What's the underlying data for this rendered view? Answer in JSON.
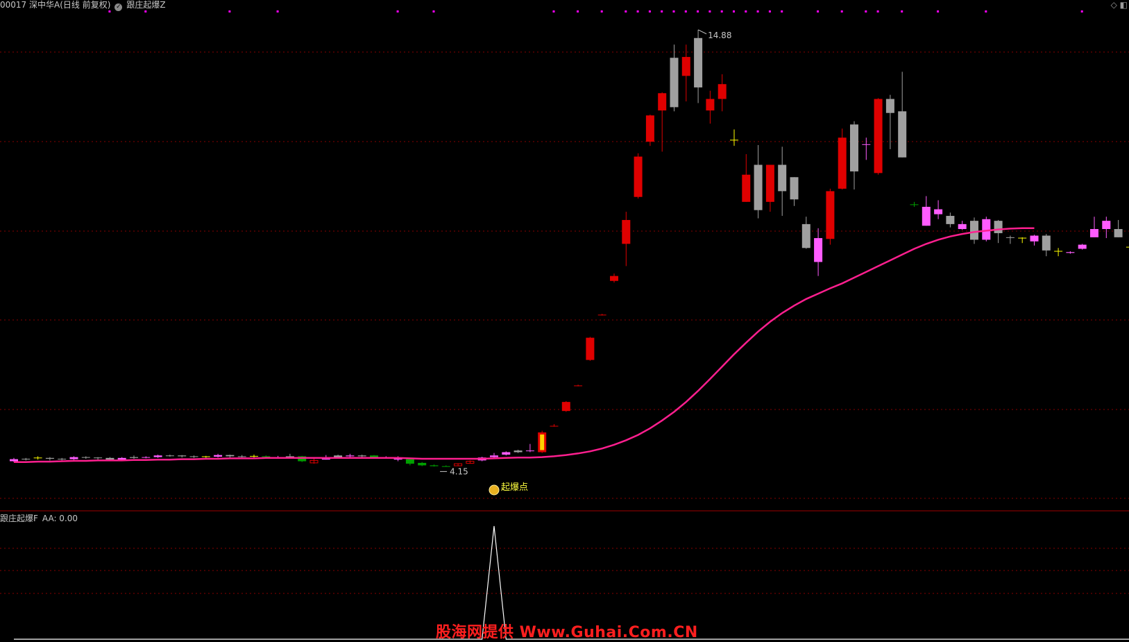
{
  "header": {
    "stock": "00017 深中华A(日线 前复权)",
    "indicator": "跟庄起爆Z"
  },
  "topright_icons": "◇ ◧",
  "sub_header": {
    "indicator": "跟庄起爆F",
    "aa": "AA: 0.00"
  },
  "watermark": "股海网提供 Www.Guhai.Com.CN",
  "colors": {
    "up": "#e00000",
    "down": "#00a000",
    "gray": "#a0a0a0",
    "magenta": "#ff5cff",
    "ma": "#ff1f8f",
    "grid": "#8a0000",
    "signal": "#ff00ff",
    "doji": "#ffff00"
  },
  "chart_data": [
    {
      "type": "candlestick",
      "ylim": [
        3.6,
        15.3
      ],
      "annotations": {
        "high_label": "14.88",
        "low_label": "4.15",
        "signal_label": "起爆点",
        "signal_icon": "money-bag-icon"
      },
      "candles": [
        [
          4.4,
          4.45,
          4.48,
          4.38,
          "m"
        ],
        [
          4.45,
          4.46,
          4.48,
          4.42,
          "g"
        ],
        [
          4.48,
          4.48,
          4.52,
          4.44,
          "y"
        ],
        [
          4.48,
          4.46,
          4.5,
          4.42,
          "g"
        ],
        [
          4.46,
          4.45,
          4.48,
          4.42,
          "g"
        ],
        [
          4.45,
          4.5,
          4.52,
          4.43,
          "m"
        ],
        [
          4.5,
          4.49,
          4.52,
          4.46,
          "g"
        ],
        [
          4.49,
          4.48,
          4.5,
          4.44,
          "g"
        ],
        [
          4.48,
          4.44,
          4.5,
          4.42,
          "g"
        ],
        [
          4.44,
          4.48,
          4.5,
          4.42,
          "m"
        ],
        [
          4.48,
          4.5,
          4.54,
          4.46,
          "g"
        ],
        [
          4.5,
          4.5,
          4.52,
          4.47,
          "m"
        ],
        [
          4.5,
          4.54,
          4.56,
          4.48,
          "m"
        ],
        [
          4.54,
          4.54,
          4.56,
          4.51,
          "g"
        ],
        [
          4.54,
          4.52,
          4.55,
          4.49,
          "g"
        ],
        [
          4.52,
          4.51,
          4.54,
          4.48,
          "g"
        ],
        [
          4.51,
          4.51,
          4.53,
          4.48,
          "y"
        ],
        [
          4.51,
          4.55,
          4.58,
          4.49,
          "m"
        ],
        [
          4.55,
          4.52,
          4.56,
          4.49,
          "g"
        ],
        [
          4.52,
          4.52,
          4.55,
          4.49,
          "g"
        ],
        [
          4.52,
          4.52,
          4.56,
          4.48,
          "y"
        ],
        [
          4.52,
          4.5,
          4.54,
          4.47,
          "dg"
        ],
        [
          4.5,
          4.5,
          4.53,
          4.47,
          "m"
        ],
        [
          4.5,
          4.52,
          4.58,
          4.47,
          "g"
        ],
        [
          4.52,
          4.4,
          4.53,
          4.38,
          "dg"
        ],
        [
          4.36,
          4.42,
          4.46,
          4.34,
          "ro"
        ],
        [
          4.44,
          4.5,
          4.55,
          4.44,
          "m"
        ],
        [
          4.5,
          4.54,
          4.56,
          4.48,
          "g"
        ],
        [
          4.54,
          4.52,
          4.58,
          4.49,
          "m"
        ],
        [
          4.52,
          4.54,
          4.56,
          4.5,
          "g"
        ],
        [
          4.54,
          4.5,
          4.55,
          4.48,
          "dg"
        ],
        [
          4.49,
          4.49,
          4.52,
          4.46,
          "m"
        ],
        [
          4.49,
          4.44,
          4.52,
          4.4,
          "m"
        ],
        [
          4.45,
          4.34,
          4.46,
          4.3,
          "dg"
        ],
        [
          4.36,
          4.3,
          4.38,
          4.28,
          "dg"
        ],
        [
          4.3,
          4.28,
          4.32,
          4.27,
          "dg"
        ],
        [
          4.28,
          4.28,
          4.3,
          4.27,
          "dg"
        ],
        [
          4.3,
          4.34,
          4.35,
          4.28,
          "ro"
        ],
        [
          4.36,
          4.4,
          4.42,
          4.34,
          "ro"
        ],
        [
          4.42,
          4.49,
          4.51,
          4.4,
          "m"
        ],
        [
          4.5,
          4.54,
          4.6,
          4.48,
          "m"
        ],
        [
          4.56,
          4.62,
          4.64,
          4.54,
          "m"
        ],
        [
          4.62,
          4.66,
          4.68,
          4.6,
          "g"
        ],
        [
          4.66,
          4.66,
          4.82,
          4.62,
          "m"
        ],
        [
          4.62,
          5.1,
          5.14,
          4.6,
          "yr"
        ],
        [
          5.26,
          5.26,
          5.3,
          5.24,
          "r"
        ],
        [
          5.62,
          5.84,
          5.86,
          5.6,
          "r"
        ],
        [
          6.24,
          6.24,
          6.26,
          6.22,
          "r"
        ],
        [
          6.86,
          7.4,
          7.42,
          6.84,
          "r"
        ],
        [
          7.96,
          7.96,
          7.98,
          7.94,
          "r"
        ],
        [
          8.78,
          8.9,
          8.96,
          8.74,
          "r"
        ],
        [
          9.68,
          10.26,
          10.46,
          9.14,
          "r"
        ],
        [
          10.82,
          11.8,
          11.88,
          10.78,
          "r"
        ],
        [
          12.16,
          12.8,
          12.82,
          12.06,
          "r"
        ],
        [
          12.92,
          13.34,
          13.36,
          11.92,
          "r"
        ],
        [
          14.2,
          13.0,
          14.52,
          12.9,
          "g"
        ],
        [
          13.76,
          14.22,
          14.52,
          13.14,
          "r"
        ],
        [
          14.68,
          13.48,
          14.88,
          13.1,
          "g"
        ],
        [
          12.92,
          13.2,
          13.4,
          12.6,
          "r"
        ],
        [
          13.2,
          13.56,
          13.8,
          12.9,
          "r"
        ],
        [
          12.2,
          12.2,
          12.46,
          12.06,
          "y"
        ],
        [
          10.7,
          11.36,
          11.86,
          10.7,
          "r"
        ],
        [
          11.6,
          10.5,
          12.08,
          10.3,
          "g"
        ],
        [
          10.7,
          11.6,
          11.6,
          10.46,
          "r"
        ],
        [
          11.6,
          10.96,
          12.04,
          10.36,
          "g"
        ],
        [
          11.3,
          10.76,
          11.3,
          10.6,
          "g"
        ],
        [
          10.16,
          9.58,
          10.34,
          9.56,
          "g"
        ],
        [
          9.82,
          9.24,
          10.06,
          8.9,
          "m"
        ],
        [
          9.8,
          10.96,
          11.02,
          9.66,
          "r"
        ],
        [
          11.02,
          12.26,
          12.48,
          11.0,
          "r"
        ],
        [
          12.58,
          11.44,
          12.66,
          11.0,
          "g"
        ],
        [
          12.1,
          12.1,
          12.26,
          11.72,
          "m"
        ],
        [
          13.2,
          11.4,
          13.22,
          11.36,
          "r"
        ],
        [
          13.2,
          12.86,
          13.3,
          11.98,
          "g"
        ],
        [
          12.9,
          11.78,
          13.86,
          11.78,
          "g"
        ],
        [
          10.64,
          10.64,
          10.7,
          10.58,
          "dg"
        ],
        [
          10.58,
          10.12,
          10.84,
          10.12,
          "m"
        ],
        [
          10.52,
          10.4,
          10.74,
          10.28,
          "m"
        ],
        [
          10.36,
          10.16,
          10.44,
          10.08,
          "g"
        ],
        [
          10.16,
          10.04,
          10.24,
          10.02,
          "m"
        ],
        [
          10.24,
          9.78,
          10.32,
          9.68,
          "g"
        ],
        [
          10.28,
          9.78,
          10.34,
          9.74,
          "m"
        ],
        [
          9.94,
          10.24,
          10.26,
          9.7,
          "g"
        ],
        [
          9.84,
          9.84,
          9.88,
          9.68,
          "g"
        ],
        [
          9.8,
          9.82,
          9.84,
          9.7,
          "y"
        ],
        [
          9.88,
          9.74,
          9.9,
          9.64,
          "m"
        ],
        [
          9.88,
          9.52,
          9.92,
          9.38,
          "g"
        ],
        [
          9.5,
          9.5,
          9.58,
          9.38,
          "y"
        ],
        [
          9.48,
          9.46,
          9.5,
          9.44,
          "m"
        ],
        [
          9.56,
          9.66,
          9.68,
          9.54,
          "m"
        ],
        [
          9.84,
          10.04,
          10.34,
          9.84,
          "m"
        ],
        [
          10.24,
          10.04,
          10.34,
          9.82,
          "m"
        ],
        [
          10.04,
          9.84,
          10.26,
          9.84,
          "g"
        ],
        [
          9.6,
          9.6,
          9.76,
          9.18,
          "y"
        ]
      ],
      "ma": [
        4.38,
        4.38,
        4.39,
        4.39,
        4.4,
        4.41,
        4.41,
        4.42,
        4.42,
        4.42,
        4.43,
        4.43,
        4.44,
        4.44,
        4.45,
        4.45,
        4.46,
        4.46,
        4.47,
        4.47,
        4.47,
        4.48,
        4.48,
        4.48,
        4.48,
        4.48,
        4.48,
        4.48,
        4.48,
        4.48,
        4.48,
        4.48,
        4.48,
        4.47,
        4.46,
        4.46,
        4.46,
        4.46,
        4.46,
        4.46,
        4.47,
        4.48,
        4.49,
        4.49,
        4.5,
        4.52,
        4.55,
        4.59,
        4.64,
        4.71,
        4.8,
        4.91,
        5.04,
        5.2,
        5.39,
        5.6,
        5.84,
        6.11,
        6.4,
        6.7,
        7.0,
        7.28,
        7.55,
        7.79,
        8.0,
        8.18,
        8.34,
        8.47,
        8.6,
        8.72,
        8.86,
        9.0,
        9.14,
        9.28,
        9.42,
        9.56,
        9.68,
        9.78,
        9.86,
        9.92,
        9.97,
        10.0,
        10.03,
        10.05,
        10.06,
        10.06
      ],
      "signal_index": 40
    },
    {
      "type": "line",
      "title": "跟庄起爆F",
      "values": [
        0,
        0,
        0,
        0,
        0,
        0,
        0,
        0,
        0,
        0,
        0,
        0,
        0,
        0,
        0,
        0,
        0,
        0,
        0,
        0,
        0,
        0,
        0,
        0,
        0,
        0,
        0,
        0,
        0,
        0,
        0,
        0,
        0,
        0,
        0,
        0,
        0,
        0,
        0,
        0,
        1,
        0,
        0,
        0,
        0,
        0,
        0,
        0,
        0,
        0,
        0,
        0,
        0,
        0,
        0,
        0,
        0,
        0,
        0,
        0,
        0,
        0,
        0,
        0,
        0,
        0,
        0,
        0,
        0,
        0,
        0,
        0,
        0,
        0,
        0,
        0,
        0,
        0,
        0,
        0,
        0,
        0,
        0,
        0,
        0,
        0,
        0,
        0,
        0,
        0,
        0,
        0,
        0,
        0
      ],
      "ylim": [
        0,
        1
      ]
    }
  ]
}
